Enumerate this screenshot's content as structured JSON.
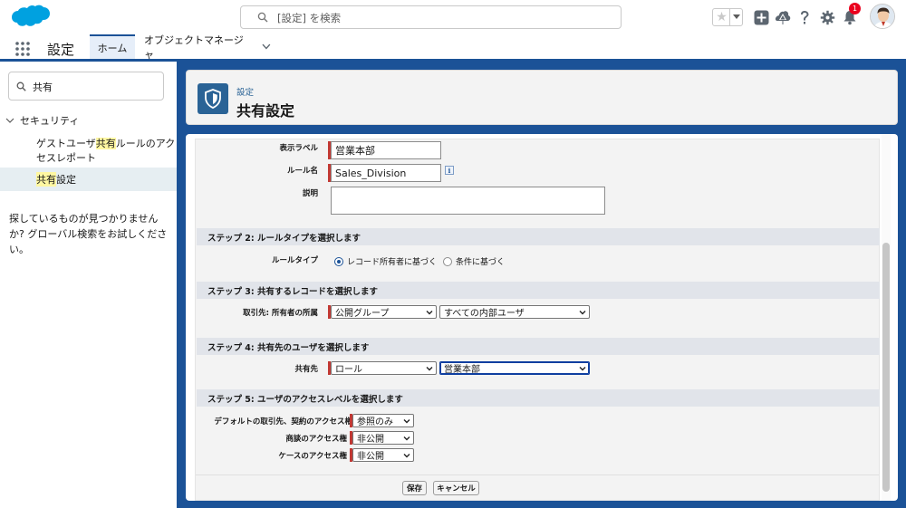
{
  "header": {
    "search_placeholder": "[設定] を検索",
    "notification_count": "1",
    "colors": {
      "brand": "#1b5297",
      "logo": "#00a1e0",
      "required": "#c23934",
      "badge": "#ea001e"
    },
    "icons": [
      "salesforce-logo",
      "search-icon",
      "star-icon",
      "chevron-down-icon",
      "add-icon",
      "trailhead-icon",
      "help-icon",
      "gear-icon",
      "bell-icon",
      "avatar"
    ]
  },
  "nav": {
    "app_name": "設定",
    "tabs": [
      {
        "label": "ホーム"
      },
      {
        "label": "オブジェクトマネージャ"
      }
    ]
  },
  "sidebar": {
    "quickfind_value": "共有",
    "parent": "セキュリティ",
    "item1_pre": "ゲストユーザ",
    "item1_hl": "共有",
    "item1_post": "ルールのアクセスレポート",
    "item2_hl": "共有",
    "item2_post": "設定",
    "not_found": "探しているものが見つかりませんか? グローバル検索をお試しください。"
  },
  "title": {
    "subtitle": "設定",
    "main": "共有設定"
  },
  "form": {
    "label_field": {
      "label": "表示ラベル",
      "value": "営業本部"
    },
    "rule_name_field": {
      "label": "ルール名",
      "value": "Sales_Division",
      "info": "i"
    },
    "description_field": {
      "label": "説明",
      "value": ""
    },
    "step2": {
      "title": "ステップ 2: ルールタイプを選択します",
      "label": "ルールタイプ",
      "options": [
        {
          "label": "レコード所有者に基づく",
          "checked": true
        },
        {
          "label": "条件に基づく",
          "checked": false
        }
      ]
    },
    "step3": {
      "title": "ステップ 3: 共有するレコードを選択します",
      "label": "取引先: 所有者の所属",
      "select1": "公開グループ",
      "select2": "すべての内部ユーザ"
    },
    "step4": {
      "title": "ステップ 4: 共有先のユーザを選択します",
      "label": "共有先",
      "select1": "ロール",
      "select2": "営業本部"
    },
    "step5": {
      "title": "ステップ 5: ユーザのアクセスレベルを選択します",
      "rows": [
        {
          "label": "デフォルトの取引先、契約のアクセス権",
          "value": "参照のみ"
        },
        {
          "label": "商談のアクセス権",
          "value": "非公開"
        },
        {
          "label": "ケースのアクセス権",
          "value": "非公開"
        }
      ]
    },
    "save_label": "保存",
    "cancel_label": "キャンセル"
  }
}
